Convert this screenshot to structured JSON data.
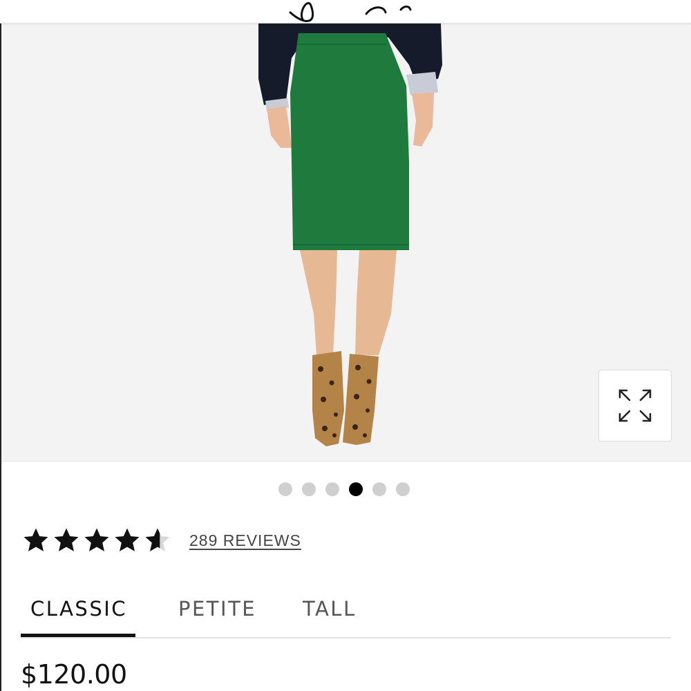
{
  "gallery": {
    "dots_total": 6,
    "active_dot": 4
  },
  "rating": {
    "stars": 4.5,
    "max_stars": 5,
    "reviews_label": "289 REVIEWS"
  },
  "fit_tabs": [
    {
      "label": "CLASSIC",
      "selected": true
    },
    {
      "label": "PETITE",
      "selected": false
    },
    {
      "label": "TALL",
      "selected": false
    }
  ],
  "price": "$120.00",
  "colors": {
    "skirt": "#1f7a3e",
    "sweater": "#151b2b",
    "dot_inactive": "#cfcfcf",
    "dot_active": "#000000"
  }
}
